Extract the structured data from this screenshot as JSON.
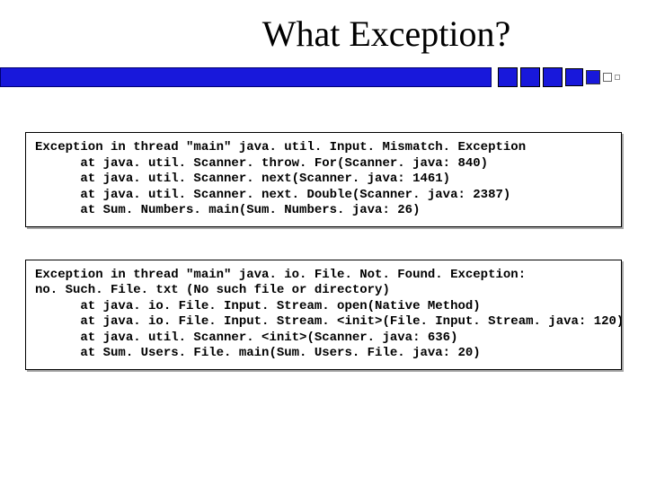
{
  "title": "What Exception?",
  "code_blocks": [
    "Exception in thread \"main\" java. util. Input. Mismatch. Exception\n      at java. util. Scanner. throw. For(Scanner. java: 840)\n      at java. util. Scanner. next(Scanner. java: 1461)\n      at java. util. Scanner. next. Double(Scanner. java: 2387)\n      at Sum. Numbers. main(Sum. Numbers. java: 26)",
    "Exception in thread \"main\" java. io. File. Not. Found. Exception:\nno. Such. File. txt (No such file or directory)\n      at java. io. File. Input. Stream. open(Native Method)\n      at java. io. File. Input. Stream. <init>(File. Input. Stream. java: 120)\n      at java. util. Scanner. <init>(Scanner. java: 636)\n      at Sum. Users. File. main(Sum. Users. File. java: 20)"
  ]
}
